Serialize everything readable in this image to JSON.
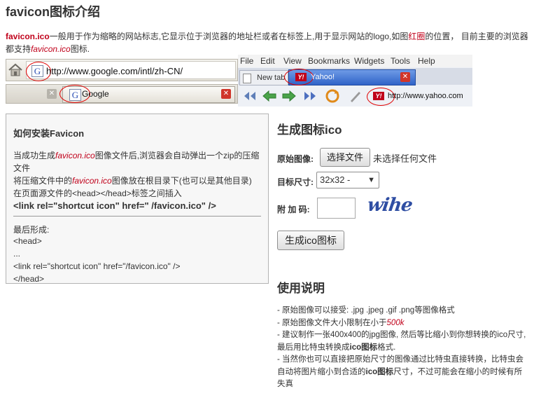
{
  "page_title": "favicon图标介绍",
  "intro": {
    "bold_term": "favicon.ico",
    "text_1": "一般用于作为缩略的网站标志,它显示位于浏览器的地址栏或者在标签上,用于显示网站的logo,如图",
    "red_box": "红圈",
    "text_2": "的位置，  目前主要的浏览器都支持",
    "file_term": "favicon.ico",
    "text_3": "图标."
  },
  "screens": {
    "google_url": "http://www.google.com/intl/zh-CN/",
    "google_tab": "Google",
    "google_logo": "G",
    "yahoo_menu": [
      "File",
      "Edit",
      "View",
      "Bookmarks",
      "Widgets",
      "Tools",
      "Help"
    ],
    "yahoo_new_tab": "New tab",
    "yahoo_tab": "Yahoo!",
    "yahoo_logo": "Y!",
    "yahoo_url": "http://www.yahoo.com",
    "close_glyph": "✕"
  },
  "install": {
    "title": "如何安装Favicon",
    "line1_a": "当成功生成",
    "line1_file": "favicon.ico",
    "line1_b": "图像文件后,浏览器会自动弹出一个zip的压缩",
    "line1_c": "文件",
    "line2_a": "将压缩文件中的",
    "line2_file": "favicon.ico",
    "line2_b": "图像放在根目录下(也可以是其他目录)",
    "line3": "在页面源文件的<head></head>标签之间插入",
    "line4": "<link rel=\"shortcut icon\" href=\" /favicon.ico\" />",
    "result_label": "最后形成:",
    "code": [
      "<head>",
      "...",
      "<link rel=\"shortcut icon\" href=\"/favicon.ico\" />",
      "</head>"
    ]
  },
  "generator": {
    "title": "生成图标ico",
    "original_label": "原始图像:",
    "choose_button": "选择文件",
    "no_file": "未选择任何文件",
    "size_label": "目标尺寸:",
    "size_value": "32x32 -",
    "captcha_label": "附 加 码:",
    "captcha_value": "",
    "captcha_image": "wihe",
    "submit_button": "生成ico图标"
  },
  "usage": {
    "title": "使用说明",
    "line1": "- 原始图像可以接受: .jpg .jpeg .gif .png等图像格式",
    "line2_a": "- 原始图像文件大小限制在小于",
    "line2_size": "500k",
    "line3_a": "- 建议制作一张400x400的jpg图像, 然后等比缩小到你想转换的ico尺寸,最后用比特虫转换成",
    "line3_bold": "ico图标",
    "line3_b": "格式.",
    "line4_a": "- 当然你也可以直接把原始尺寸的图像通过比特虫直接转换，比特虫会自动将图片缩小到合适的",
    "line4_bold": "ico图标",
    "line4_b": "尺寸，不过可能会在缩小的时候有所失真"
  },
  "colors": {
    "accent_red": "#c0001a",
    "link_blue": "#2f4ea3"
  }
}
